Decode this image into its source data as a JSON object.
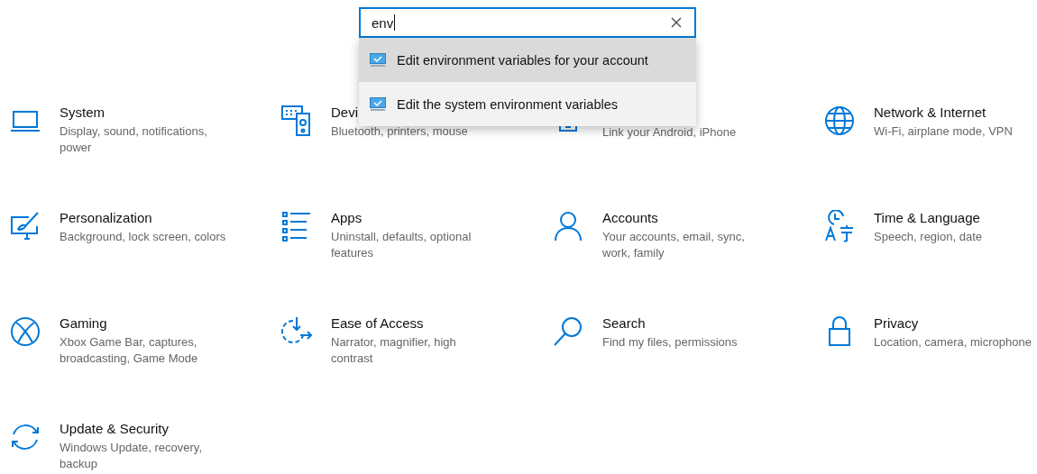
{
  "search": {
    "value": "env"
  },
  "suggestions": [
    {
      "label": "Edit environment variables for your account",
      "selected": true
    },
    {
      "label": "Edit the system environment variables",
      "selected": false
    }
  ],
  "categories": [
    {
      "title": "System",
      "description": "Display, sound, notifications, power"
    },
    {
      "title": "Devi",
      "description": "Bluetooth, printers, mouse"
    },
    {
      "description": "Link your Android, iPhone"
    },
    {
      "title": "Network & Internet",
      "description": "Wi-Fi, airplane mode, VPN"
    },
    {
      "title": "Personalization",
      "description": "Background, lock screen, colors"
    },
    {
      "title": "Apps",
      "description": "Uninstall, defaults, optional features"
    },
    {
      "title": "Accounts",
      "description": "Your accounts, email, sync, work, family"
    },
    {
      "title": "Time & Language",
      "description": "Speech, region, date"
    },
    {
      "title": "Gaming",
      "description": "Xbox Game Bar, captures, broadcasting, Game Mode"
    },
    {
      "title": "Ease of Access",
      "description": "Narrator, magnifier, high contrast"
    },
    {
      "title": "Search",
      "description": "Find my files, permissions"
    },
    {
      "title": "Privacy",
      "description": "Location, camera, microphone"
    },
    {
      "title": "Update & Security",
      "description": "Windows Update, recovery, backup"
    }
  ]
}
